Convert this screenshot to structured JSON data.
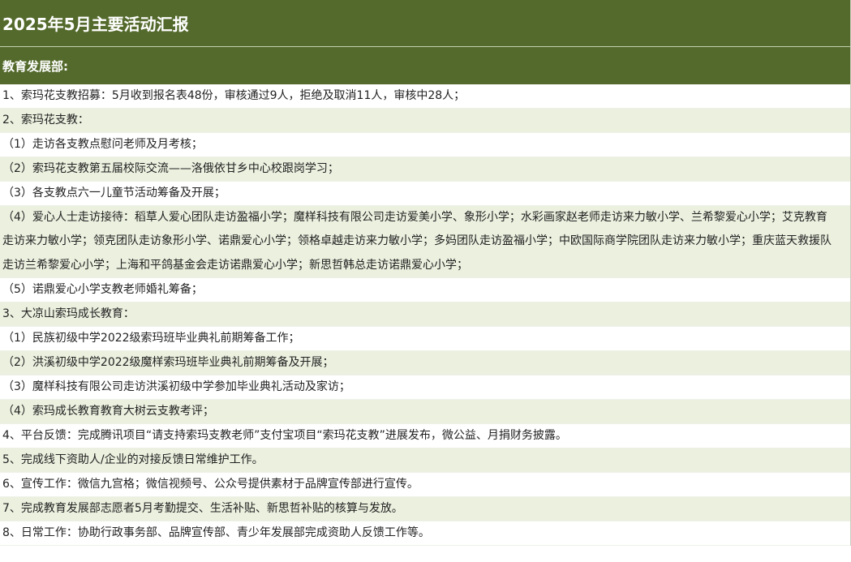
{
  "report": {
    "title": "2025年5月主要活动汇报",
    "section_title": "教育发展部:",
    "rows": [
      "1、索玛花支教招募：5月收到报名表48份，审核通过9人，拒绝及取消11人，审核中28人；",
      "2、索玛花支教：",
      "（1）走访各支教点慰问老师及月考核；",
      "（2）索玛花支教第五届校际交流——洛俄依甘乡中心校跟岗学习；",
      "（3）各支教点六一儿童节活动筹备及开展；",
      "（4）爱心人士走访接待：稻草人爱心团队走访盈福小学；魔样科技有限公司走访爱美小学、象形小学；水彩画家赵老师走访来力敏小学、兰希黎爱心小学；艾克教育走访来力敏小学；领克团队走访象形小学、诺鼎爱心小学；领格卓越走访来力敏小学；多妈团队走访盈福小学；中欧国际商学院团队走访来力敏小学；重庆蓝天救援队走访兰希黎爱心小学；上海和平鸽基金会走访诺鼎爱心小学；新思哲韩总走访诺鼎爱心小学；",
      "（5）诺鼎爱心小学支教老师婚礼筹备；",
      "3、大凉山索玛成长教育：",
      "（1）民族初级中学2022级索玛班毕业典礼前期筹备工作；",
      "（2）洪溪初级中学2022级魔样索玛班毕业典礼前期筹备及开展；",
      "（3）魔样科技有限公司走访洪溪初级中学参加毕业典礼活动及家访；",
      "（4）索玛成长教育教育大树云支教考评；",
      "4、平台反馈：完成腾讯项目“请支持索玛支教老师”支付宝项目“索玛花支教”进展发布，微公益、月捐财务披露。",
      "5、完成线下资助人/企业的对接反馈日常维护工作。",
      "6、宣传工作：微信九宫格；微信视频号、公众号提供素材于品牌宣传部进行宣传。",
      "7、完成教育发展部志愿者5月考勤提交、生活补贴、新思哲补贴的核算与发放。",
      "8、日常工作：协助行政事务部、品牌宣传部、青少年发展部完成资助人反馈工作等。"
    ]
  }
}
